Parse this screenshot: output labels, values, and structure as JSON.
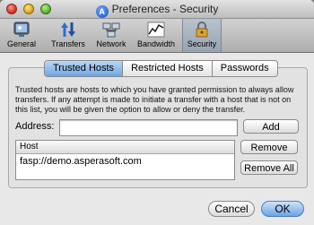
{
  "window": {
    "title": "Preferences - Security"
  },
  "toolbar": {
    "items": [
      {
        "label": "General",
        "icon": "general-icon"
      },
      {
        "label": "Transfers",
        "icon": "transfers-icon"
      },
      {
        "label": "Network",
        "icon": "network-icon"
      },
      {
        "label": "Bandwidth",
        "icon": "bandwidth-icon"
      },
      {
        "label": "Security",
        "icon": "security-icon",
        "active": true
      }
    ]
  },
  "tabs": [
    {
      "label": "Trusted Hosts",
      "active": true
    },
    {
      "label": "Restricted Hosts"
    },
    {
      "label": "Passwords"
    }
  ],
  "description": "Trusted hosts are hosts to which you have granted permission to always allow transfers. If any attempt is made to initiate a transfer with a host that is not on this list, you will be given the option to allow or deny the transfer.",
  "address": {
    "label": "Address:",
    "value": ""
  },
  "buttons": {
    "add": "Add",
    "remove": "Remove",
    "remove_all": "Remove All",
    "cancel": "Cancel",
    "ok": "OK"
  },
  "host_list": {
    "header": "Host",
    "rows": [
      "fasp://demo.asperasoft.com"
    ]
  },
  "colors": {
    "accent": "#6fa6e3",
    "window_bg": "#e8e8e8"
  }
}
